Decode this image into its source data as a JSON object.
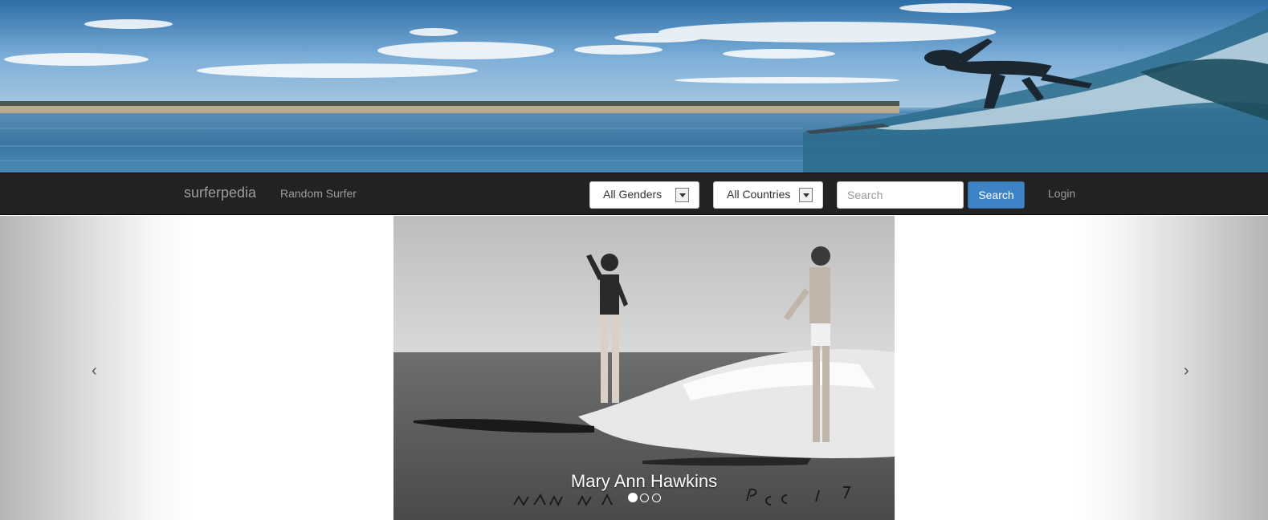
{
  "navbar": {
    "brand": "surferpedia",
    "random_link": "Random Surfer",
    "gender_select": "All Genders",
    "country_select": "All Countries",
    "search_placeholder": "Search",
    "search_button": "Search",
    "login_link": "Login"
  },
  "carousel": {
    "caption": "Mary Ann Hawkins",
    "prev_control": "‹",
    "next_control": "›",
    "slide_count": 3,
    "active_slide": 1
  },
  "colors": {
    "navbar_bg": "#222222",
    "nav_text": "#9d9d9d",
    "search_button_bg": "#3c84c6"
  }
}
